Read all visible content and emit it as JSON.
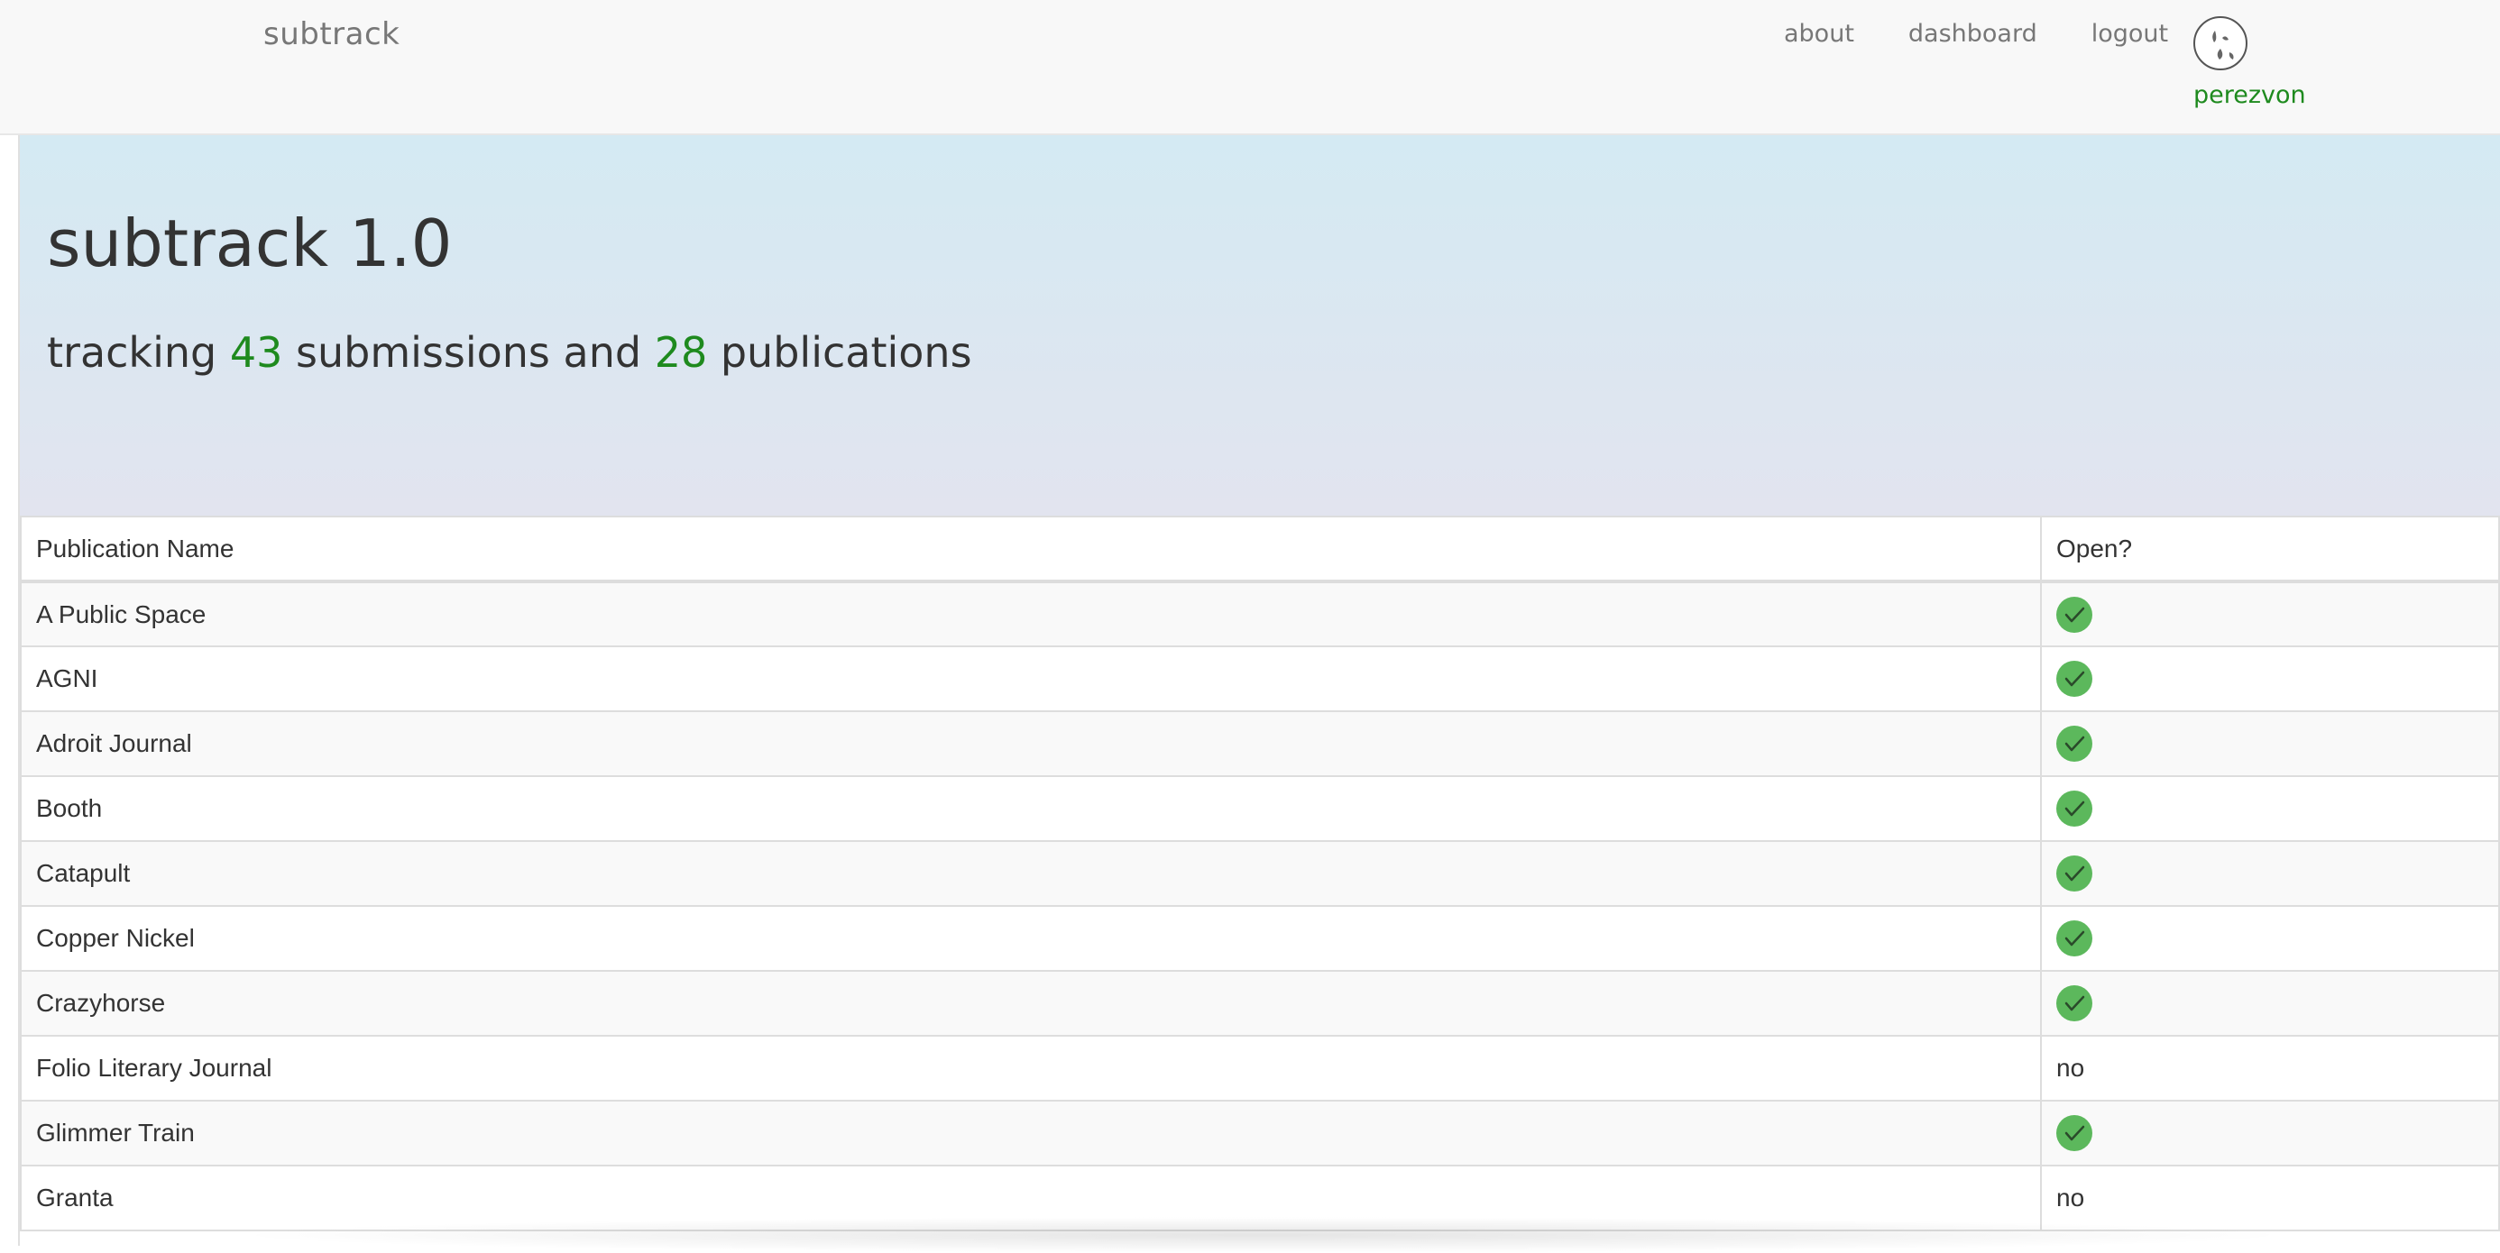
{
  "navbar": {
    "brand": "subtrack",
    "links": [
      "about",
      "dashboard",
      "logout"
    ],
    "username": "perezvon"
  },
  "jumbotron": {
    "title": "subtrack 1.0",
    "sub_prefix": "tracking",
    "submissions_count": "43",
    "sub_mid": "submissions and",
    "publications_count": "28",
    "sub_suffix": "publications"
  },
  "table": {
    "headers": [
      "Publication Name",
      "Open?"
    ],
    "rows": [
      {
        "name": "A Public Space",
        "open": "yes"
      },
      {
        "name": "AGNI",
        "open": "yes"
      },
      {
        "name": "Adroit Journal",
        "open": "yes"
      },
      {
        "name": "Booth",
        "open": "yes"
      },
      {
        "name": "Catapult",
        "open": "yes"
      },
      {
        "name": "Copper Nickel",
        "open": "yes"
      },
      {
        "name": "Crazyhorse",
        "open": "yes"
      },
      {
        "name": "Folio Literary Journal",
        "open": "no"
      },
      {
        "name": "Glimmer Train",
        "open": "yes"
      },
      {
        "name": "Granta",
        "open": "no"
      }
    ]
  },
  "colors": {
    "accent_green": "#1e8a1e",
    "check_green": "#5cb85c",
    "navbar_bg": "#f8f8f8"
  },
  "icons": {
    "avatar": "user-avatar-icon",
    "open_yes": "green-check-icon"
  }
}
